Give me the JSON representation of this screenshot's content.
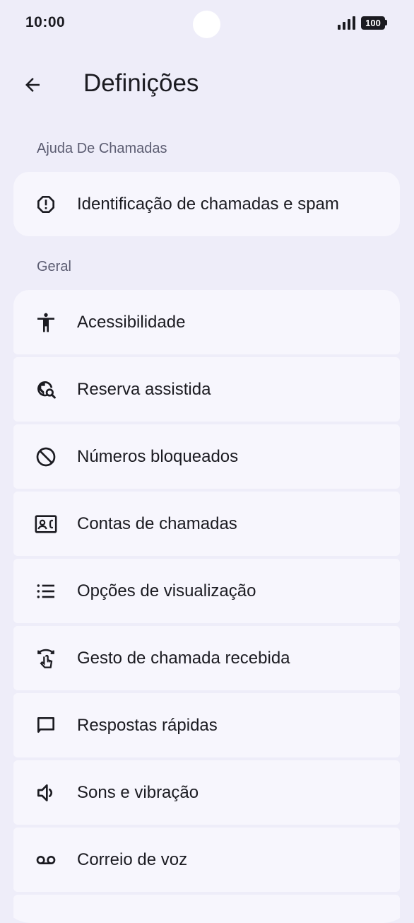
{
  "status_bar": {
    "time": "10:00",
    "battery": "100"
  },
  "app_bar": {
    "title": "Definições"
  },
  "sections": [
    {
      "header": "Ajuda De Chamadas",
      "items": [
        {
          "label": "Identificação de chamadas e spam",
          "icon": "spam-warning-icon"
        }
      ]
    },
    {
      "header": "Geral",
      "items": [
        {
          "label": "Acessibilidade",
          "icon": "accessibility-icon"
        },
        {
          "label": "Reserva assistida",
          "icon": "travel-explore-icon"
        },
        {
          "label": "Números bloqueados",
          "icon": "block-icon"
        },
        {
          "label": "Contas de chamadas",
          "icon": "contact-phone-icon"
        },
        {
          "label": "Opções de visualização",
          "icon": "list-icon"
        },
        {
          "label": "Gesto de chamada recebida",
          "icon": "swipe-gesture-icon"
        },
        {
          "label": "Respostas rápidas",
          "icon": "chat-bubble-icon"
        },
        {
          "label": "Sons e vibração",
          "icon": "volume-icon"
        },
        {
          "label": "Correio de voz",
          "icon": "voicemail-icon"
        }
      ]
    }
  ],
  "colors": {
    "background": "#eeedf9",
    "card": "#f7f6fd",
    "text": "#1b1b21",
    "section_header": "#5c5d72"
  }
}
